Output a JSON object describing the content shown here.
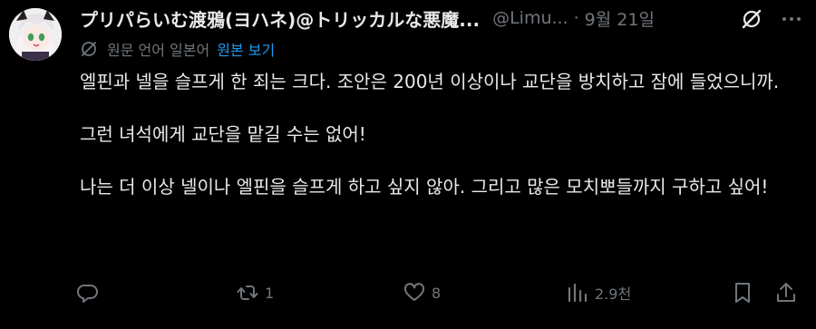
{
  "tweet": {
    "display_name": "プリパらいむ渡鴉(ヨハネ)@トリッカルな悪魔...",
    "handle": "@Limu...",
    "separator": "·",
    "date": "9월 21일",
    "translation": {
      "note": "원문 언어 일본어",
      "show_original": "원본 보기"
    },
    "paragraphs": [
      "엘핀과 넬을 슬프게 한 죄는 크다. 조안은 200년 이상이나 교단을 방치하고 잠에 들었으니까.",
      "그런 녀석에게 교단을 맡길 수는 없어!",
      "나는 더 이상 넬이나 엘핀을 슬프게 하고 싶지 않아. 그리고 많은 모치뽀들까지 구하고 싶어!"
    ],
    "actions": {
      "reply_icon": "reply-icon",
      "retweet_icon": "retweet-icon",
      "retweet_count": "1",
      "like_icon": "heart-icon",
      "like_count": "8",
      "views_icon": "views-icon",
      "views_count": "2.9천",
      "bookmark_icon": "bookmark-icon",
      "share_icon": "share-icon"
    }
  },
  "colors": {
    "background": "#000000",
    "text": "#e7e9ea",
    "muted": "#71767b",
    "link": "#1d9bf0"
  }
}
